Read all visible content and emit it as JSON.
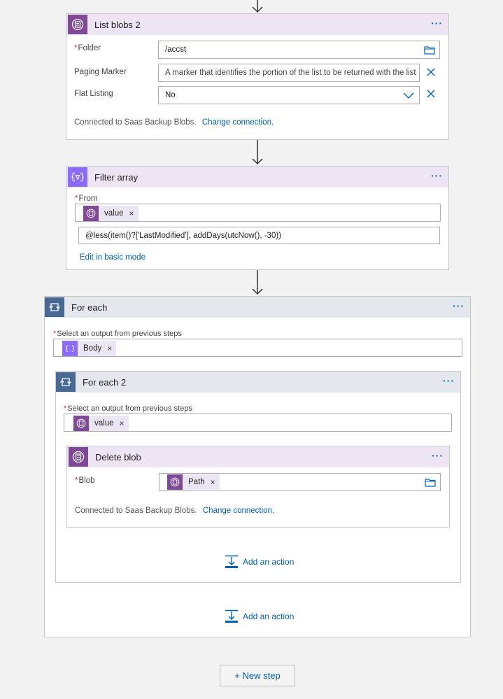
{
  "list_blobs": {
    "title": "List blobs 2",
    "folder_label": "Folder",
    "folder_value": "/accst",
    "paging_label": "Paging Marker",
    "paging_placeholder": "A marker that identifies the portion of the list to be returned with the list",
    "flat_label": "Flat Listing",
    "flat_value": "No",
    "connected_text": "Connected to Saas Backup Blobs.",
    "change_connection": "Change connection."
  },
  "filter_array": {
    "title": "Filter array",
    "from_label": "From",
    "token_label": "value",
    "expression": "@less(item()?['LastModified'], addDays(utcNow(), -30))",
    "edit_basic": "Edit in basic mode"
  },
  "for_each": {
    "title": "For each",
    "select_label": "Select an output from previous steps",
    "token_label": "Body",
    "add_action": "Add an action"
  },
  "for_each_2": {
    "title": "For each 2",
    "select_label": "Select an output from previous steps",
    "token_label": "value",
    "add_action": "Add an action"
  },
  "delete_blob": {
    "title": "Delete blob",
    "blob_label": "Blob",
    "token_label": "Path",
    "connected_text": "Connected to Saas Backup Blobs.",
    "change_connection": "Change connection."
  },
  "new_step": "+ New step",
  "token_x": "×",
  "required_mark": "*",
  "more_dots": "···",
  "colors": {
    "blob_purple": "#804998",
    "filter_purple": "#8c6cff",
    "loop_blue": "#486991",
    "link_blue": "#0062ad"
  }
}
